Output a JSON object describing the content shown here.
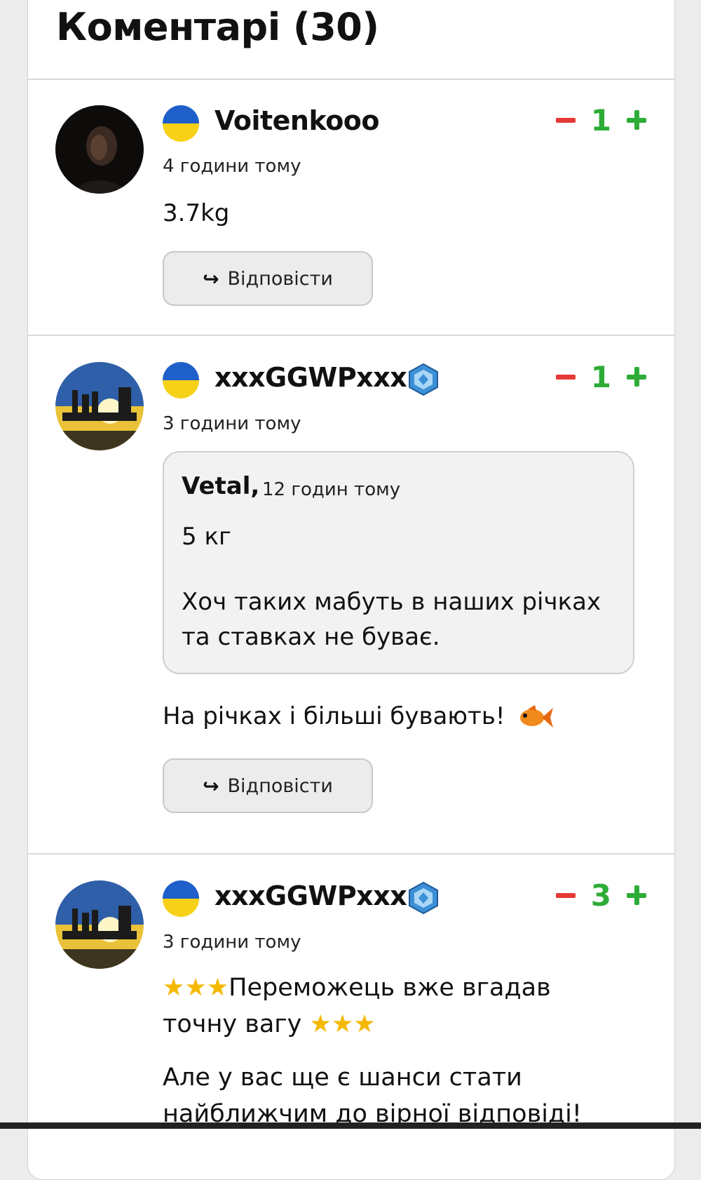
{
  "header": {
    "title": "Коментарі (30)"
  },
  "comments": [
    {
      "username": "Voitenkooo",
      "time": "4 години тому",
      "votes": "1",
      "text": "3.7kg",
      "reply_label": "Відповісти",
      "avatar_icon": "user-photo-dark"
    },
    {
      "username": "xxxGGWPxxx",
      "time": "3 години тому",
      "votes": "1",
      "quote": {
        "author": "Vetal",
        "time": "12 годин тому",
        "line1": "5 кг",
        "line2": "Хоч таких мабуть в наших річках та ставках не буває."
      },
      "text": "На річках і більші бувають!",
      "reply_label": "Відповісти",
      "avatar_icon": "user-photo-sunset"
    },
    {
      "username": "xxxGGWPxxx",
      "time": "3 години тому",
      "votes": "3",
      "text_part1": "Переможець вже вгадав",
      "text_part2": "точну вагу",
      "text_part3": "Але у вас ще є шанси стати",
      "text_part4": "найближчим до вірної відповіді!",
      "avatar_icon": "user-photo-sunset"
    }
  ],
  "colors": {
    "minus": "#e53935",
    "plus": "#2eac38",
    "flag_blue": "#1f5fc9",
    "flag_yellow": "#f7d117",
    "badge": "#3d8fd6"
  }
}
